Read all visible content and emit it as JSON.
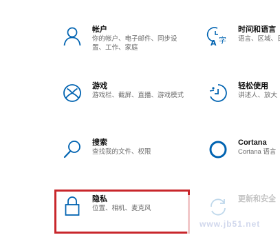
{
  "tiles": {
    "accounts": {
      "title": "帐户",
      "desc": [
        "你的帐户、电子邮件、同步设",
        "置、工作、家庭"
      ]
    },
    "time_language": {
      "title": "时间和语言",
      "desc": [
        "语言、区域、日"
      ]
    },
    "gaming": {
      "title": "游戏",
      "desc": [
        "游戏栏、截屏、直播、游戏模式"
      ]
    },
    "ease_of_access": {
      "title": "轻松使用",
      "desc": [
        "讲述人、放大"
      ]
    },
    "search": {
      "title": "搜索",
      "desc": [
        "查找我的文件、权限"
      ]
    },
    "cortana": {
      "title": "Cortana",
      "desc": [
        "Cortana 语言"
      ]
    },
    "privacy": {
      "title": "隐私",
      "desc": [
        "位置、相机、麦克风"
      ]
    },
    "update_security": {
      "title": "更新和安全",
      "desc": [
        ""
      ]
    }
  },
  "watermark": "www.jb51.net",
  "colors": {
    "accent": "#0063b1",
    "highlight_border": "#c8262b",
    "title": "#111111",
    "desc": "#6b6b6b"
  },
  "icons": {
    "accounts": "person-icon",
    "time_language": "time-language-icon",
    "gaming": "xbox-icon",
    "ease_of_access": "ease-of-access-icon",
    "search": "search-icon",
    "cortana": "cortana-icon",
    "privacy": "lock-icon",
    "update_security": "update-icon"
  }
}
